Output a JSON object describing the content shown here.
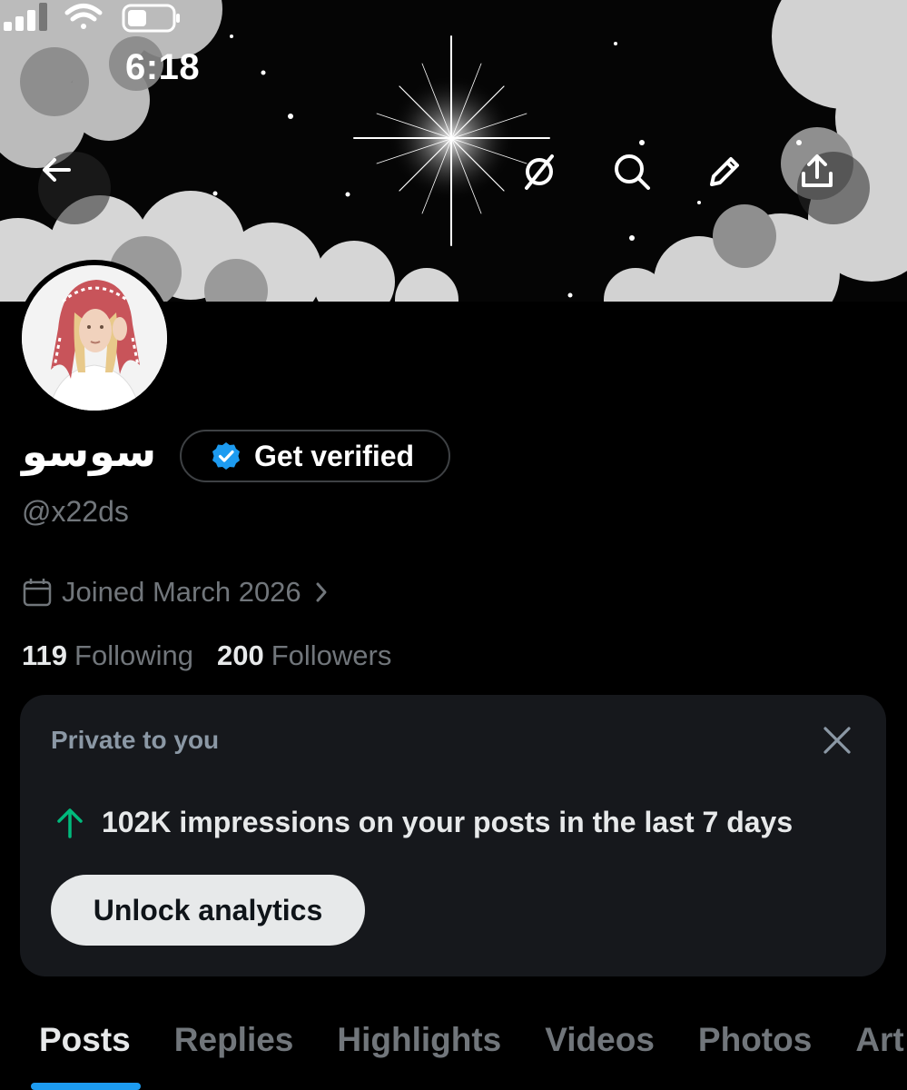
{
  "status_bar": {
    "time": "6:18"
  },
  "nav": {
    "back_icon": "arrow-left-icon",
    "grok_icon": "slash-circle-icon",
    "search_icon": "search-icon",
    "edit_icon": "pencil-icon",
    "share_icon": "share-icon"
  },
  "profile": {
    "name": "سوسو",
    "verify_label": "Get verified",
    "handle": "@x22ds",
    "joined": "Joined March 2026",
    "following_count": "119",
    "following_label": "Following",
    "followers_count": "200",
    "followers_label": "Followers"
  },
  "private_card": {
    "title": "Private to you",
    "impressions_text": "102K impressions on your posts in the last 7 days",
    "unlock_label": "Unlock analytics"
  },
  "tabs": [
    {
      "label": "Posts",
      "active": true
    },
    {
      "label": "Replies",
      "active": false
    },
    {
      "label": "Highlights",
      "active": false
    },
    {
      "label": "Videos",
      "active": false
    },
    {
      "label": "Photos",
      "active": false
    },
    {
      "label": "Art",
      "active": false
    }
  ],
  "colors": {
    "accent": "#1d9bf0",
    "verified": "#1d9bf0",
    "trend_up": "#00ba7c",
    "background": "#000000",
    "card": "#16181c"
  }
}
